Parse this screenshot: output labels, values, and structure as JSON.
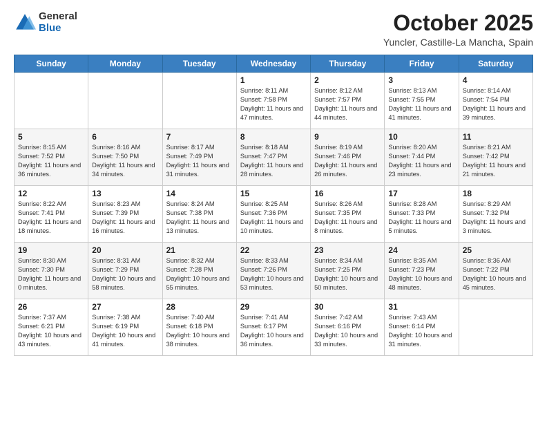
{
  "header": {
    "logo_general": "General",
    "logo_blue": "Blue",
    "month": "October 2025",
    "location": "Yuncler, Castille-La Mancha, Spain"
  },
  "weekdays": [
    "Sunday",
    "Monday",
    "Tuesday",
    "Wednesday",
    "Thursday",
    "Friday",
    "Saturday"
  ],
  "weeks": [
    [
      {
        "day": "",
        "info": ""
      },
      {
        "day": "",
        "info": ""
      },
      {
        "day": "",
        "info": ""
      },
      {
        "day": "1",
        "info": "Sunrise: 8:11 AM\nSunset: 7:58 PM\nDaylight: 11 hours and 47 minutes."
      },
      {
        "day": "2",
        "info": "Sunrise: 8:12 AM\nSunset: 7:57 PM\nDaylight: 11 hours and 44 minutes."
      },
      {
        "day": "3",
        "info": "Sunrise: 8:13 AM\nSunset: 7:55 PM\nDaylight: 11 hours and 41 minutes."
      },
      {
        "day": "4",
        "info": "Sunrise: 8:14 AM\nSunset: 7:54 PM\nDaylight: 11 hours and 39 minutes."
      }
    ],
    [
      {
        "day": "5",
        "info": "Sunrise: 8:15 AM\nSunset: 7:52 PM\nDaylight: 11 hours and 36 minutes."
      },
      {
        "day": "6",
        "info": "Sunrise: 8:16 AM\nSunset: 7:50 PM\nDaylight: 11 hours and 34 minutes."
      },
      {
        "day": "7",
        "info": "Sunrise: 8:17 AM\nSunset: 7:49 PM\nDaylight: 11 hours and 31 minutes."
      },
      {
        "day": "8",
        "info": "Sunrise: 8:18 AM\nSunset: 7:47 PM\nDaylight: 11 hours and 28 minutes."
      },
      {
        "day": "9",
        "info": "Sunrise: 8:19 AM\nSunset: 7:46 PM\nDaylight: 11 hours and 26 minutes."
      },
      {
        "day": "10",
        "info": "Sunrise: 8:20 AM\nSunset: 7:44 PM\nDaylight: 11 hours and 23 minutes."
      },
      {
        "day": "11",
        "info": "Sunrise: 8:21 AM\nSunset: 7:42 PM\nDaylight: 11 hours and 21 minutes."
      }
    ],
    [
      {
        "day": "12",
        "info": "Sunrise: 8:22 AM\nSunset: 7:41 PM\nDaylight: 11 hours and 18 minutes."
      },
      {
        "day": "13",
        "info": "Sunrise: 8:23 AM\nSunset: 7:39 PM\nDaylight: 11 hours and 16 minutes."
      },
      {
        "day": "14",
        "info": "Sunrise: 8:24 AM\nSunset: 7:38 PM\nDaylight: 11 hours and 13 minutes."
      },
      {
        "day": "15",
        "info": "Sunrise: 8:25 AM\nSunset: 7:36 PM\nDaylight: 11 hours and 10 minutes."
      },
      {
        "day": "16",
        "info": "Sunrise: 8:26 AM\nSunset: 7:35 PM\nDaylight: 11 hours and 8 minutes."
      },
      {
        "day": "17",
        "info": "Sunrise: 8:28 AM\nSunset: 7:33 PM\nDaylight: 11 hours and 5 minutes."
      },
      {
        "day": "18",
        "info": "Sunrise: 8:29 AM\nSunset: 7:32 PM\nDaylight: 11 hours and 3 minutes."
      }
    ],
    [
      {
        "day": "19",
        "info": "Sunrise: 8:30 AM\nSunset: 7:30 PM\nDaylight: 11 hours and 0 minutes."
      },
      {
        "day": "20",
        "info": "Sunrise: 8:31 AM\nSunset: 7:29 PM\nDaylight: 10 hours and 58 minutes."
      },
      {
        "day": "21",
        "info": "Sunrise: 8:32 AM\nSunset: 7:28 PM\nDaylight: 10 hours and 55 minutes."
      },
      {
        "day": "22",
        "info": "Sunrise: 8:33 AM\nSunset: 7:26 PM\nDaylight: 10 hours and 53 minutes."
      },
      {
        "day": "23",
        "info": "Sunrise: 8:34 AM\nSunset: 7:25 PM\nDaylight: 10 hours and 50 minutes."
      },
      {
        "day": "24",
        "info": "Sunrise: 8:35 AM\nSunset: 7:23 PM\nDaylight: 10 hours and 48 minutes."
      },
      {
        "day": "25",
        "info": "Sunrise: 8:36 AM\nSunset: 7:22 PM\nDaylight: 10 hours and 45 minutes."
      }
    ],
    [
      {
        "day": "26",
        "info": "Sunrise: 7:37 AM\nSunset: 6:21 PM\nDaylight: 10 hours and 43 minutes."
      },
      {
        "day": "27",
        "info": "Sunrise: 7:38 AM\nSunset: 6:19 PM\nDaylight: 10 hours and 41 minutes."
      },
      {
        "day": "28",
        "info": "Sunrise: 7:40 AM\nSunset: 6:18 PM\nDaylight: 10 hours and 38 minutes."
      },
      {
        "day": "29",
        "info": "Sunrise: 7:41 AM\nSunset: 6:17 PM\nDaylight: 10 hours and 36 minutes."
      },
      {
        "day": "30",
        "info": "Sunrise: 7:42 AM\nSunset: 6:16 PM\nDaylight: 10 hours and 33 minutes."
      },
      {
        "day": "31",
        "info": "Sunrise: 7:43 AM\nSunset: 6:14 PM\nDaylight: 10 hours and 31 minutes."
      },
      {
        "day": "",
        "info": ""
      }
    ]
  ]
}
